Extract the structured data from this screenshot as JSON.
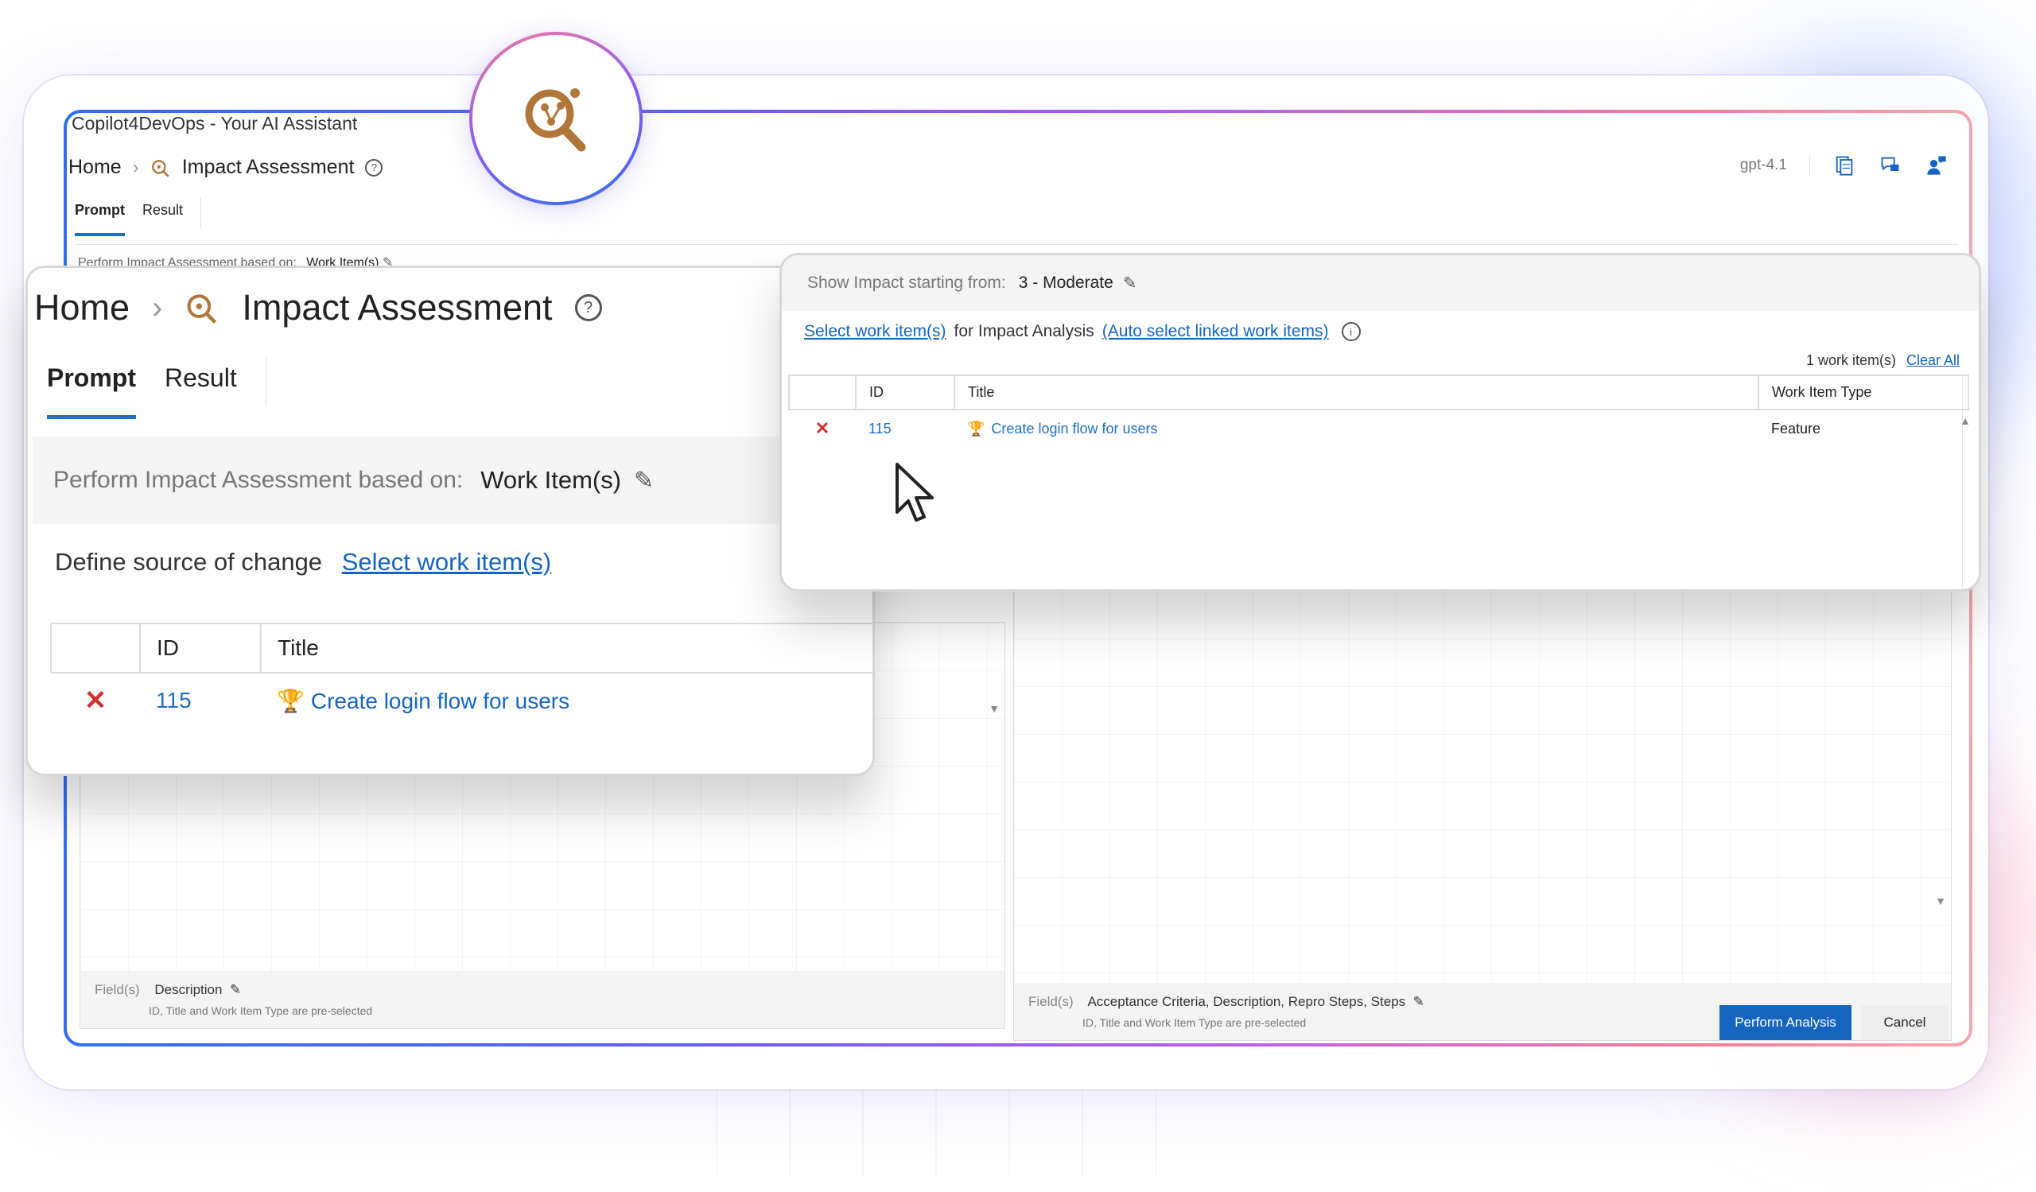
{
  "colors": {
    "accent": "#1565c0",
    "logo_brown": "#b0763a",
    "remove_red": "#d32f2f",
    "trophy_purple": "#6a1b9a"
  },
  "window": {
    "title": "Copilot4DevOps - Your AI Assistant",
    "breadcrumb": {
      "home": "Home",
      "page": "Impact Assessment",
      "page_icon": "impact-assessment-icon"
    },
    "model": "gpt-4.1",
    "tabs": [
      "Prompt",
      "Result"
    ],
    "perform_label": "Perform Impact Assessment based on:",
    "perform_value": "Work Item(s)",
    "left_fields": {
      "label": "Field(s)",
      "value": "Description",
      "note": "ID, Title and Work Item Type are pre-selected"
    },
    "right_fields": {
      "label": "Field(s)",
      "value": "Acceptance Criteria,  Description,  Repro Steps,  Steps",
      "note": "ID, Title and Work Item Type are pre-selected"
    },
    "buttons": {
      "perform": "Perform Analysis",
      "cancel": "Cancel"
    }
  },
  "zoom_left": {
    "home": "Home",
    "page": "Impact Assessment",
    "tabs": [
      "Prompt",
      "Result"
    ],
    "perform_label": "Perform Impact Assessment based on:",
    "perform_value": "Work Item(s)",
    "define_label": "Define source of change",
    "define_link": "Select work item(s)",
    "table": {
      "headers": [
        "",
        "ID",
        "Title"
      ],
      "rows": [
        {
          "id": "115",
          "title": "Create login flow for users"
        }
      ]
    }
  },
  "zoom_right": {
    "impact_label": "Show Impact starting from:",
    "impact_value": "3 - Moderate",
    "select_link": "Select work item(s)",
    "select_text": "for Impact Analysis",
    "auto_link": "(Auto select linked work items)",
    "count": "1 work item(s)",
    "clear": "Clear All",
    "table": {
      "headers": [
        "",
        "ID",
        "Title",
        "Work Item Type"
      ],
      "rows": [
        {
          "id": "115",
          "title": "Create login flow for users",
          "type": "Feature"
        }
      ]
    }
  }
}
